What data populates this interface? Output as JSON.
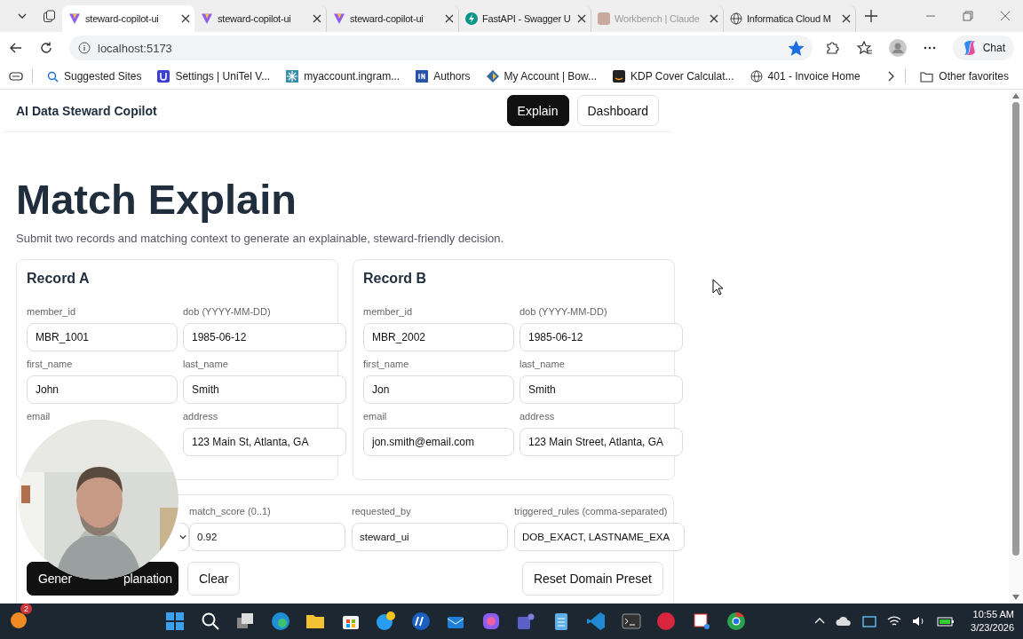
{
  "browser": {
    "tabs": [
      {
        "title": "steward-copilot-ui",
        "selected": true,
        "dimmed": false
      },
      {
        "title": "steward-copilot-ui",
        "selected": false,
        "dimmed": false
      },
      {
        "title": "steward-copilot-ui",
        "selected": false,
        "dimmed": false
      },
      {
        "title": "FastAPI - Swagger U",
        "selected": false,
        "dimmed": false
      },
      {
        "title": "Workbench | Claude",
        "selected": false,
        "dimmed": true
      },
      {
        "title": "Informatica Cloud M",
        "selected": false,
        "dimmed": false
      }
    ],
    "address": "localhost:5173",
    "favorited": true,
    "chat_label": "Chat",
    "bookmarks": [
      {
        "label": "Suggested Sites"
      },
      {
        "label": "Settings | UniTel V..."
      },
      {
        "label": "myaccount.ingram..."
      },
      {
        "label": "Authors"
      },
      {
        "label": "My Account | Bow..."
      },
      {
        "label": "KDP Cover Calculat..."
      },
      {
        "label": "401 - Invoice Home"
      }
    ],
    "other_favorites": "Other favorites"
  },
  "app": {
    "brand": "AI Data Steward Copilot",
    "nav": [
      {
        "label": "Explain",
        "selected": true
      },
      {
        "label": "Dashboard",
        "selected": false
      }
    ],
    "heading": "Match Explain",
    "subtitle": "Submit two records and matching context to generate an explainable, steward-friendly decision.",
    "records": [
      {
        "title": "Record A",
        "fields": [
          {
            "label": "member_id",
            "value": "MBR_1001"
          },
          {
            "label": "dob (YYYY-MM-DD)",
            "value": "1985-06-12"
          },
          {
            "label": "first_name",
            "value": "John"
          },
          {
            "label": "last_name",
            "value": "Smith"
          },
          {
            "label": "email"
          },
          {
            "label": "address",
            "value": "123 Main St, Atlanta, GA"
          }
        ]
      },
      {
        "title": "Record B",
        "fields": [
          {
            "label": "member_id",
            "value": "MBR_2002"
          },
          {
            "label": "dob (YYYY-MM-DD)",
            "value": "1985-06-12"
          },
          {
            "label": "first_name",
            "value": "Jon"
          },
          {
            "label": "last_name",
            "value": "Smith"
          },
          {
            "label": "email",
            "value": "jon.smith@email.com"
          },
          {
            "label": "address",
            "value": "123 Main Street, Atlanta, GA"
          }
        ]
      }
    ],
    "context_fields": [
      {
        "kind": "select"
      },
      {
        "kind": "text",
        "label": "match_score (0..1)",
        "value": "0.92"
      },
      {
        "kind": "text",
        "label": "requested_by",
        "value": "steward_ui"
      },
      {
        "kind": "text",
        "label": "triggered_rules (comma-separated)",
        "value": "DOB_EXACT, LASTNAME_EXA"
      }
    ],
    "actions": [
      {
        "label_parts": [
          "Gener",
          "planation"
        ],
        "primary": true
      },
      {
        "label": "Clear",
        "primary": false
      },
      {
        "label": "Reset Domain Preset",
        "primary": false
      }
    ]
  },
  "taskbar": {
    "notification_count": "2",
    "time": "10:55 AM",
    "date": "3/23/2026"
  }
}
